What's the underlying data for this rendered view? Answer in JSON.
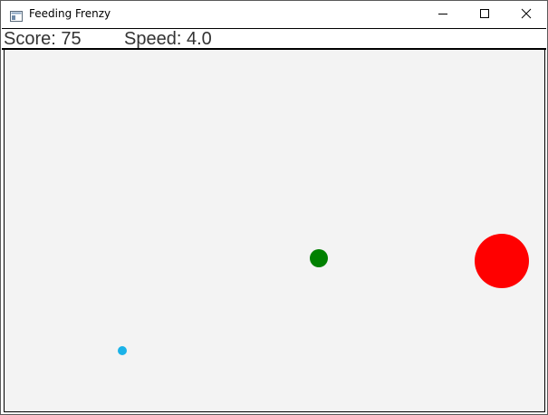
{
  "window": {
    "title": "Feeding Frenzy",
    "app_icon": "window-app-icon",
    "controls": {
      "minimize_icon": "minimize-icon",
      "maximize_icon": "maximize-icon",
      "close_icon": "close-icon"
    }
  },
  "status": {
    "score_text": "Score: 75",
    "speed_text": "Speed: 4.0"
  },
  "game": {
    "background_color": "#f3f3f3",
    "fish": [
      {
        "role": "player",
        "color": "#008000"
      },
      {
        "role": "large-enemy",
        "color": "#ff0000"
      },
      {
        "role": "small-prey",
        "color": "#1ab2e8"
      }
    ]
  }
}
